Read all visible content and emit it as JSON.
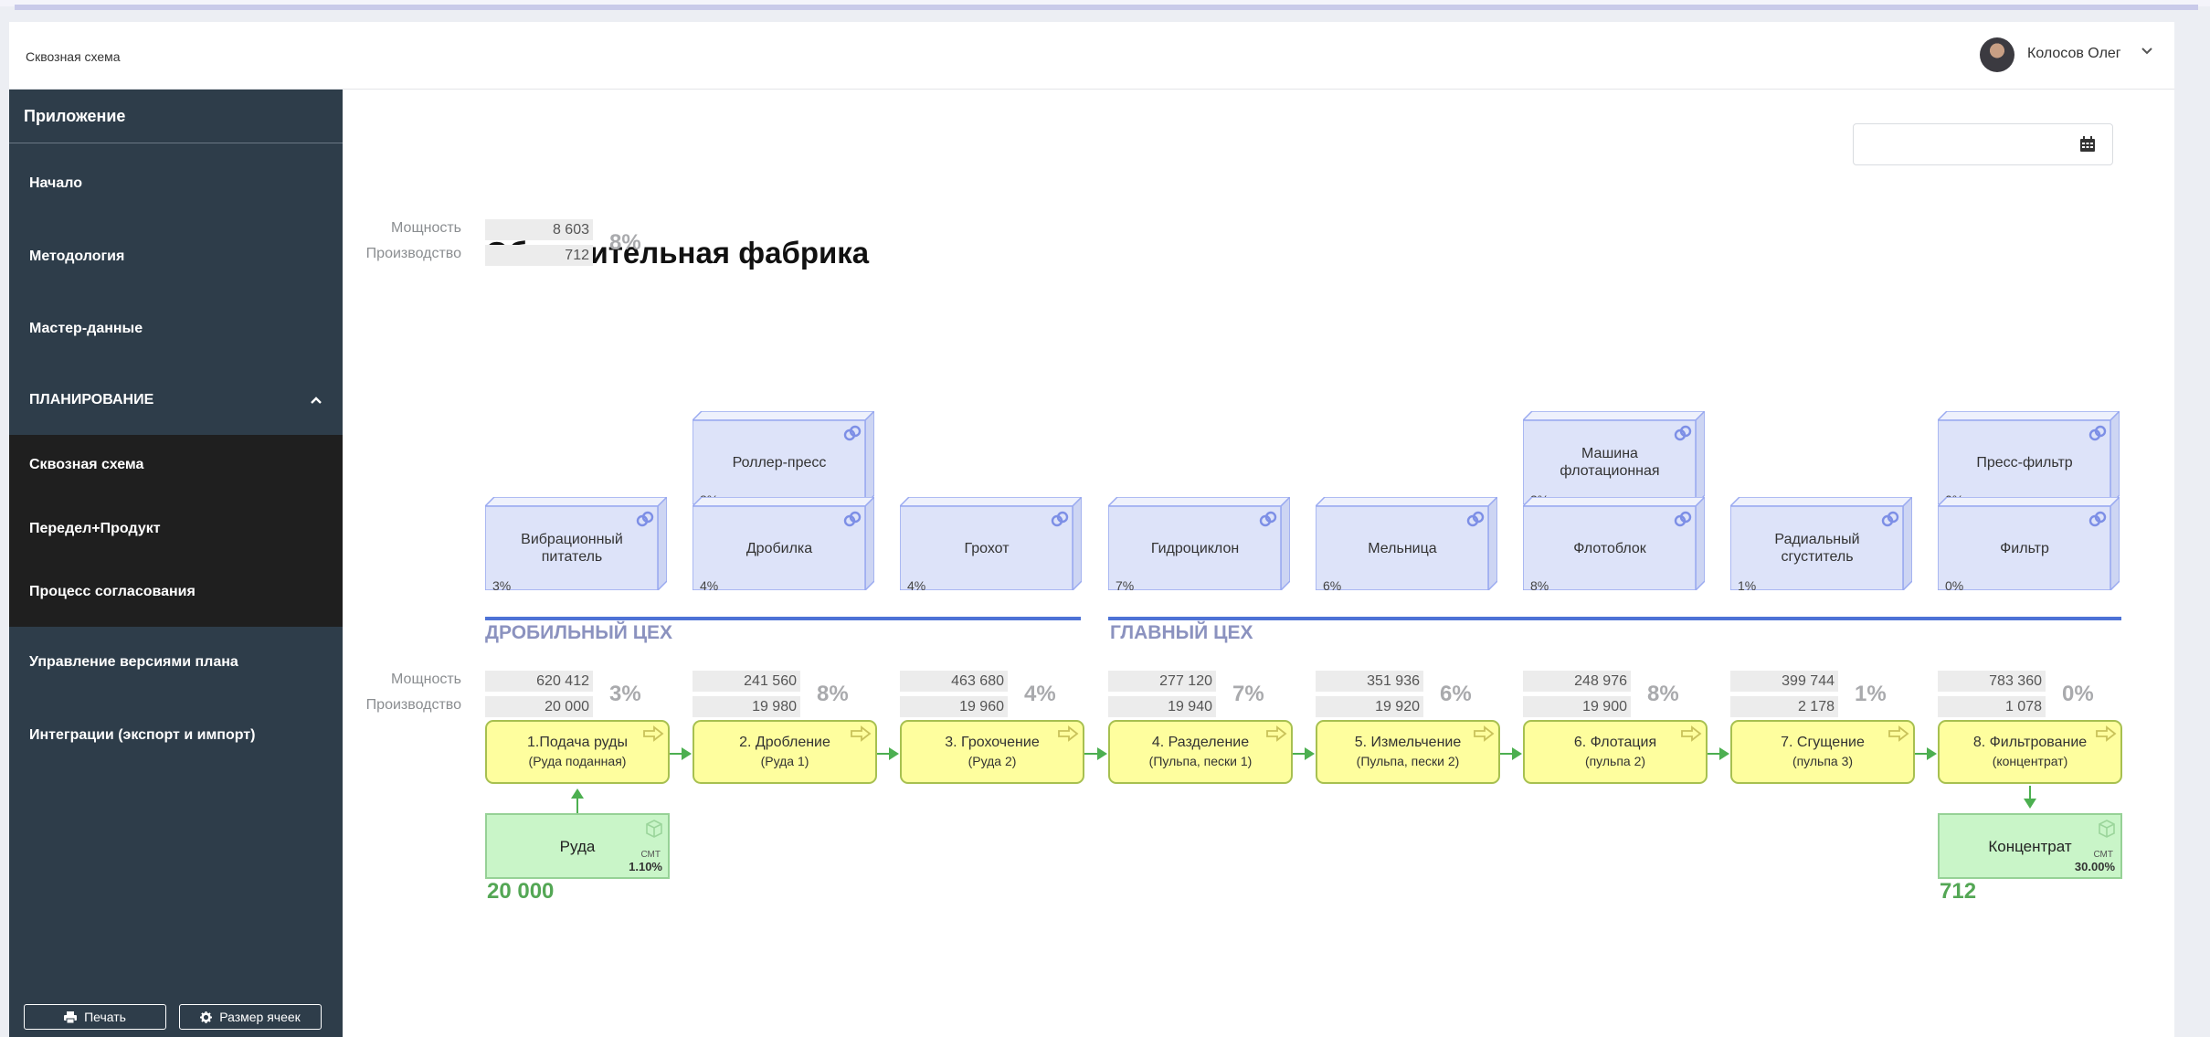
{
  "header": {
    "title": "Сквозная схема",
    "user_name": "Колосов Олег"
  },
  "sidebar": {
    "app_title": "Приложение",
    "items": [
      "Начало",
      "Методология",
      "Мастер-данные"
    ],
    "section_label": "ПЛАНИРОВАНИЕ",
    "section_items": [
      "Сквозная схема",
      "Передел+Продукт",
      "Процесс согласования"
    ],
    "bottom_items": [
      "Управление версиями плана",
      "Интеграции (экспорт и импорт)"
    ],
    "print_button": "Печать",
    "cell_size_button": "Размер ячеек"
  },
  "plant": {
    "title": "Обогатительная фабрика",
    "capacity_label": "Мощность",
    "production_label": "Производство",
    "capacity": "8 603",
    "production": "712",
    "pct": "8%"
  },
  "equipment_upper": [
    {
      "name": "Роллер-пресс",
      "pct": "8%"
    },
    {
      "name": "Машина флотационная",
      "pct": "3%"
    },
    {
      "name": "Пресс-фильтр",
      "pct": "0%"
    }
  ],
  "equipment_lower": [
    {
      "name": "Вибрационный питатель",
      "pct": "3%"
    },
    {
      "name": "Дробилка",
      "pct": "4%"
    },
    {
      "name": "Грохот",
      "pct": "4%"
    },
    {
      "name": "Гидроциклон",
      "pct": "7%"
    },
    {
      "name": "Мельница",
      "pct": "6%"
    },
    {
      "name": "Флотоблок",
      "pct": "8%"
    },
    {
      "name": "Радиальный сгуститель",
      "pct": "1%"
    },
    {
      "name": "Фильтр",
      "pct": "0%"
    }
  ],
  "shops": [
    "ДРОБИЛЬНЫЙ ЦЕХ",
    "ГЛАВНЫЙ ЦЕХ"
  ],
  "processes": [
    {
      "capacity": "620 412",
      "production": "20 000",
      "pct": "3%",
      "name": "1.Подача руды",
      "product": "(Руда поданная)"
    },
    {
      "capacity": "241 560",
      "production": "19 980",
      "pct": "8%",
      "name": "2. Дробление",
      "product": "(Руда 1)"
    },
    {
      "capacity": "463 680",
      "production": "19 960",
      "pct": "4%",
      "name": "3. Грохочение",
      "product": "(Руда 2)"
    },
    {
      "capacity": "277 120",
      "production": "19 940",
      "pct": "7%",
      "name": "4. Разделение",
      "product": "(Пульпа, пески 1)"
    },
    {
      "capacity": "351 936",
      "production": "19 920",
      "pct": "6%",
      "name": "5. Измельчение",
      "product": "(Пульпа, пески 2)"
    },
    {
      "capacity": "248 976",
      "production": "19 900",
      "pct": "8%",
      "name": "6. Флотация",
      "product": "(пульпа 2)"
    },
    {
      "capacity": "399 744",
      "production": "2 178",
      "pct": "1%",
      "name": "7. Сгущение",
      "product": "(пульпа 3)"
    },
    {
      "capacity": "783 360",
      "production": "1 078",
      "pct": "0%",
      "name": "8. Фильтрование",
      "product": "(концентрат)"
    }
  ],
  "materials": [
    {
      "name": "Руда",
      "unit": "СМТ",
      "pct": "1.10%",
      "value": "20 000"
    },
    {
      "name": "Концентрат",
      "unit": "СМТ",
      "pct": "30.00%",
      "value": "712"
    }
  ],
  "colors": {
    "sidebar_bg": "#2e3d4a",
    "equipment_fill": "#dde3f9",
    "equipment_border": "#9aaaf0",
    "process_fill": "#fefe9e",
    "material_fill": "#c9f5c8",
    "flow_arrow": "#4caf50",
    "shop_line": "#4d72d6"
  }
}
